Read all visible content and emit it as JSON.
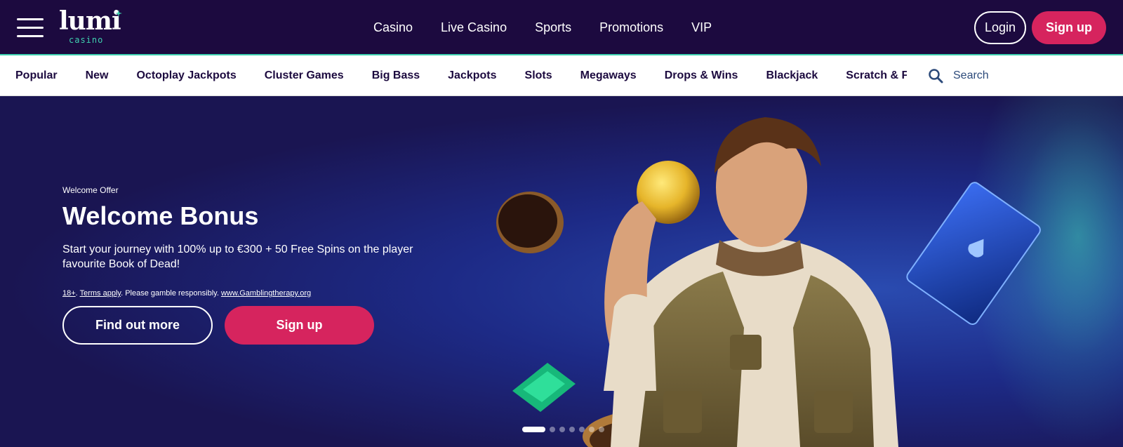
{
  "header": {
    "logo_text": "lumi",
    "logo_sub": "casino",
    "nav": [
      "Casino",
      "Live Casino",
      "Sports",
      "Promotions",
      "VIP"
    ],
    "login_label": "Login",
    "signup_label": "Sign up"
  },
  "categories": {
    "items": [
      "Popular",
      "New",
      "Octoplay Jackpots",
      "Cluster Games",
      "Big Bass",
      "Jackpots",
      "Slots",
      "Megaways",
      "Drops & Wins",
      "Blackjack",
      "Scratch & Fun"
    ],
    "search_placeholder": "Search"
  },
  "hero": {
    "eyebrow": "Welcome Offer",
    "title": "Welcome Bonus",
    "description": "Start your journey with 100% up to €300 + 50 Free Spins on the player favourite Book of Dead!",
    "legal_age": "18+",
    "legal_sep": ". ",
    "legal_terms": "Terms apply",
    "legal_text": ". Please gamble responsibly. ",
    "legal_link": "www.Gamblingtherapy.org",
    "find_out_label": "Find out more",
    "signup_label": "Sign up",
    "slides": {
      "count": 7,
      "active": 0
    }
  },
  "colors": {
    "header_bg": "#1c0a3f",
    "accent_teal": "#3fd1b0",
    "cta_pink": "#d6245e"
  },
  "icons": [
    "menu-icon",
    "search-icon",
    "star-icon"
  ]
}
